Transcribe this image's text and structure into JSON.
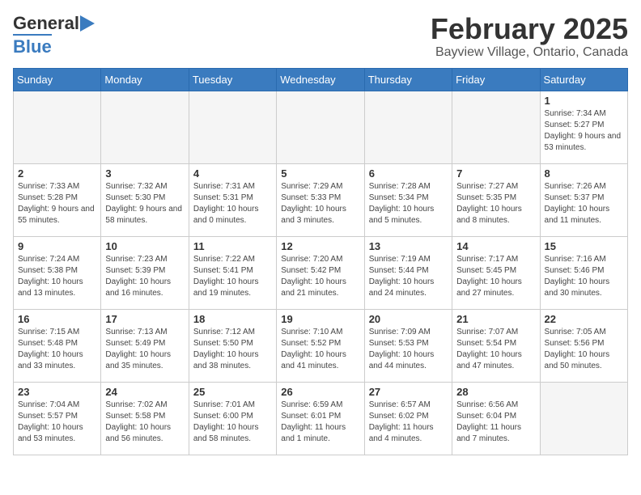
{
  "header": {
    "logo_general": "General",
    "logo_blue": "Blue",
    "month_title": "February 2025",
    "location": "Bayview Village, Ontario, Canada"
  },
  "days_of_week": [
    "Sunday",
    "Monday",
    "Tuesday",
    "Wednesday",
    "Thursday",
    "Friday",
    "Saturday"
  ],
  "weeks": [
    [
      {
        "day": "",
        "info": ""
      },
      {
        "day": "",
        "info": ""
      },
      {
        "day": "",
        "info": ""
      },
      {
        "day": "",
        "info": ""
      },
      {
        "day": "",
        "info": ""
      },
      {
        "day": "",
        "info": ""
      },
      {
        "day": "1",
        "info": "Sunrise: 7:34 AM\nSunset: 5:27 PM\nDaylight: 9 hours and 53 minutes."
      }
    ],
    [
      {
        "day": "2",
        "info": "Sunrise: 7:33 AM\nSunset: 5:28 PM\nDaylight: 9 hours and 55 minutes."
      },
      {
        "day": "3",
        "info": "Sunrise: 7:32 AM\nSunset: 5:30 PM\nDaylight: 9 hours and 58 minutes."
      },
      {
        "day": "4",
        "info": "Sunrise: 7:31 AM\nSunset: 5:31 PM\nDaylight: 10 hours and 0 minutes."
      },
      {
        "day": "5",
        "info": "Sunrise: 7:29 AM\nSunset: 5:33 PM\nDaylight: 10 hours and 3 minutes."
      },
      {
        "day": "6",
        "info": "Sunrise: 7:28 AM\nSunset: 5:34 PM\nDaylight: 10 hours and 5 minutes."
      },
      {
        "day": "7",
        "info": "Sunrise: 7:27 AM\nSunset: 5:35 PM\nDaylight: 10 hours and 8 minutes."
      },
      {
        "day": "8",
        "info": "Sunrise: 7:26 AM\nSunset: 5:37 PM\nDaylight: 10 hours and 11 minutes."
      }
    ],
    [
      {
        "day": "9",
        "info": "Sunrise: 7:24 AM\nSunset: 5:38 PM\nDaylight: 10 hours and 13 minutes."
      },
      {
        "day": "10",
        "info": "Sunrise: 7:23 AM\nSunset: 5:39 PM\nDaylight: 10 hours and 16 minutes."
      },
      {
        "day": "11",
        "info": "Sunrise: 7:22 AM\nSunset: 5:41 PM\nDaylight: 10 hours and 19 minutes."
      },
      {
        "day": "12",
        "info": "Sunrise: 7:20 AM\nSunset: 5:42 PM\nDaylight: 10 hours and 21 minutes."
      },
      {
        "day": "13",
        "info": "Sunrise: 7:19 AM\nSunset: 5:44 PM\nDaylight: 10 hours and 24 minutes."
      },
      {
        "day": "14",
        "info": "Sunrise: 7:17 AM\nSunset: 5:45 PM\nDaylight: 10 hours and 27 minutes."
      },
      {
        "day": "15",
        "info": "Sunrise: 7:16 AM\nSunset: 5:46 PM\nDaylight: 10 hours and 30 minutes."
      }
    ],
    [
      {
        "day": "16",
        "info": "Sunrise: 7:15 AM\nSunset: 5:48 PM\nDaylight: 10 hours and 33 minutes."
      },
      {
        "day": "17",
        "info": "Sunrise: 7:13 AM\nSunset: 5:49 PM\nDaylight: 10 hours and 35 minutes."
      },
      {
        "day": "18",
        "info": "Sunrise: 7:12 AM\nSunset: 5:50 PM\nDaylight: 10 hours and 38 minutes."
      },
      {
        "day": "19",
        "info": "Sunrise: 7:10 AM\nSunset: 5:52 PM\nDaylight: 10 hours and 41 minutes."
      },
      {
        "day": "20",
        "info": "Sunrise: 7:09 AM\nSunset: 5:53 PM\nDaylight: 10 hours and 44 minutes."
      },
      {
        "day": "21",
        "info": "Sunrise: 7:07 AM\nSunset: 5:54 PM\nDaylight: 10 hours and 47 minutes."
      },
      {
        "day": "22",
        "info": "Sunrise: 7:05 AM\nSunset: 5:56 PM\nDaylight: 10 hours and 50 minutes."
      }
    ],
    [
      {
        "day": "23",
        "info": "Sunrise: 7:04 AM\nSunset: 5:57 PM\nDaylight: 10 hours and 53 minutes."
      },
      {
        "day": "24",
        "info": "Sunrise: 7:02 AM\nSunset: 5:58 PM\nDaylight: 10 hours and 56 minutes."
      },
      {
        "day": "25",
        "info": "Sunrise: 7:01 AM\nSunset: 6:00 PM\nDaylight: 10 hours and 58 minutes."
      },
      {
        "day": "26",
        "info": "Sunrise: 6:59 AM\nSunset: 6:01 PM\nDaylight: 11 hours and 1 minute."
      },
      {
        "day": "27",
        "info": "Sunrise: 6:57 AM\nSunset: 6:02 PM\nDaylight: 11 hours and 4 minutes."
      },
      {
        "day": "28",
        "info": "Sunrise: 6:56 AM\nSunset: 6:04 PM\nDaylight: 11 hours and 7 minutes."
      },
      {
        "day": "",
        "info": ""
      }
    ]
  ]
}
